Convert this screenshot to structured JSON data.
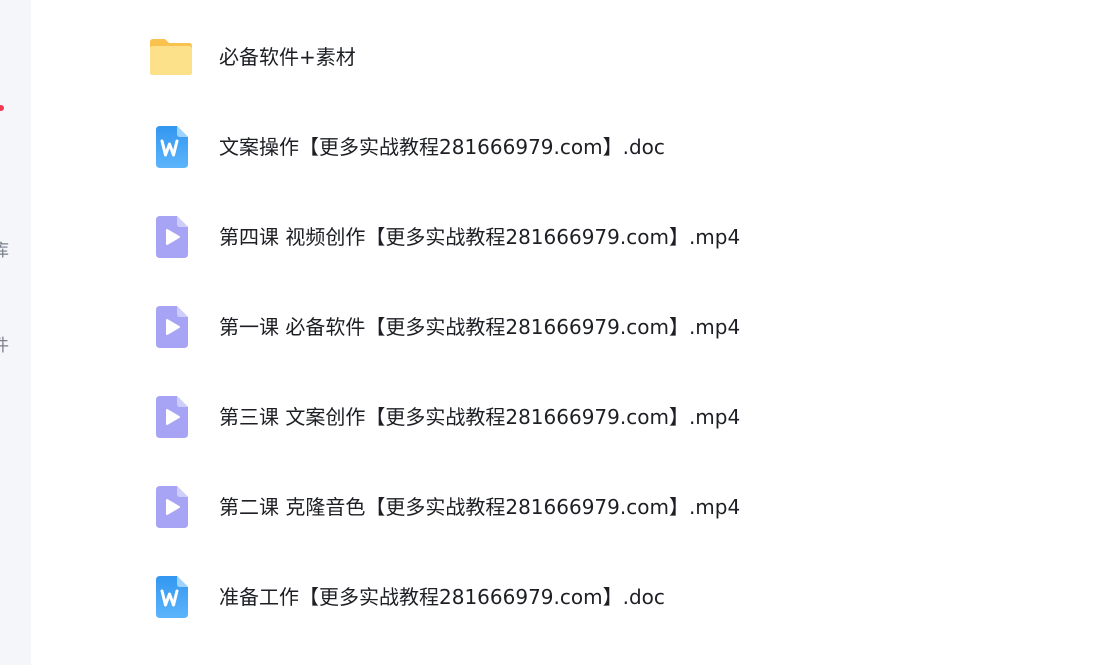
{
  "sidebar": {
    "partial_label_1": "库",
    "partial_label_2": "件"
  },
  "files": [
    {
      "name": "必备软件+素材",
      "icon": "folder-icon"
    },
    {
      "name": "文案操作【更多实战教程281666979.com】.doc",
      "icon": "word-doc-icon"
    },
    {
      "name": "第四课 视频创作【更多实战教程281666979.com】.mp4",
      "icon": "video-file-icon"
    },
    {
      "name": "第一课 必备软件【更多实战教程281666979.com】.mp4",
      "icon": "video-file-icon"
    },
    {
      "name": "第三课 文案创作【更多实战教程281666979.com】.mp4",
      "icon": "video-file-icon"
    },
    {
      "name": "第二课 克隆音色【更多实战教程281666979.com】.mp4",
      "icon": "video-file-icon"
    },
    {
      "name": "准备工作【更多实战教程281666979.com】.doc",
      "icon": "word-doc-icon"
    }
  ],
  "colors": {
    "folder": "#fcd36b",
    "word": "#3a9bf5",
    "video": "#a7a3f5",
    "sidebar_bg": "#f5f6fa",
    "notification_dot": "#f23a56"
  }
}
